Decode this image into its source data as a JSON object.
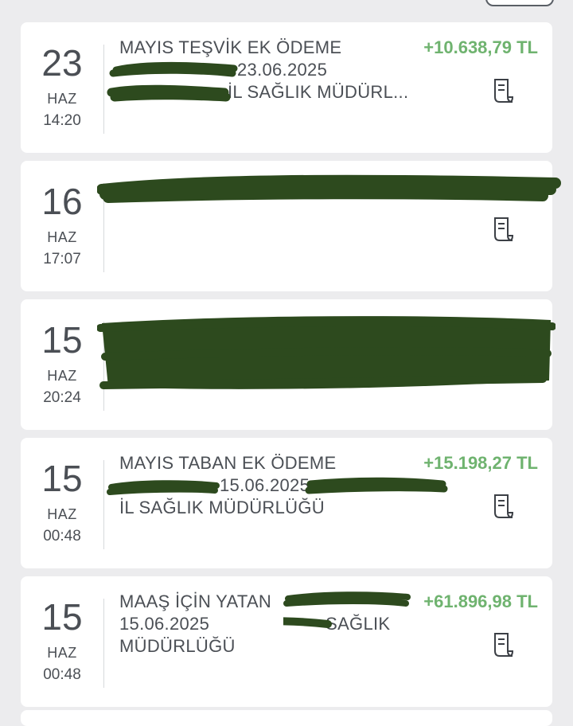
{
  "colors": {
    "amount_green": "#6fb36f",
    "text_gray": "#4b4f55",
    "background": "#ececee",
    "redaction": "#2d4a1e"
  },
  "transactions": [
    {
      "day": "23",
      "month": "HAZ",
      "time": "14:20",
      "lines": [
        "MAYIS TEŞVİK EK ÖDEME",
        "23.06.2025",
        "İL SAĞLIK MÜDÜRL..."
      ],
      "amount": "+10.638,79 TL",
      "icon": "receipt-icon"
    },
    {
      "day": "16",
      "month": "HAZ",
      "time": "17:07",
      "lines": [],
      "amount": "",
      "icon": "receipt-icon"
    },
    {
      "day": "15",
      "month": "HAZ",
      "time": "20:24",
      "lines": [],
      "amount": "",
      "icon": ""
    },
    {
      "day": "15",
      "month": "HAZ",
      "time": "00:48",
      "lines": [
        "MAYIS TABAN EK ÖDEME",
        "15.06.2025",
        "İL SAĞLIK MÜDÜRLÜĞÜ"
      ],
      "amount": "+15.198,27 TL",
      "icon": "receipt-icon"
    },
    {
      "day": "15",
      "month": "HAZ",
      "time": "00:48",
      "lines": [
        "MAAŞ İÇİN YATAN",
        "15.06.2025",
        "SAĞLIK",
        "MÜDÜRLÜĞÜ"
      ],
      "amount": "+61.896,98 TL",
      "icon": "receipt-icon"
    }
  ]
}
